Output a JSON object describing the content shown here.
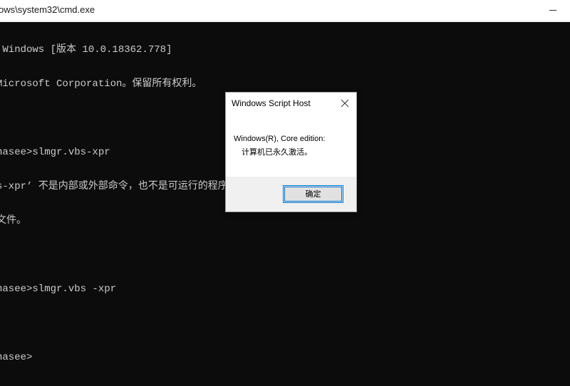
{
  "window": {
    "title": "ows\\system32\\cmd.exe"
  },
  "console": {
    "lines": [
      " Windows [版本 10.0.18362.778]",
      "Microsoft Corporation。保留所有权利。",
      "",
      "nasee>slmgr.vbs-xpr",
      "s-xpr’ 不是内部或外部命令，也不是可运行的程序",
      "文件。",
      "",
      "nasee>slmgr.vbs -xpr",
      "",
      "nasee>"
    ]
  },
  "dialog": {
    "title": "Windows Script Host",
    "message_line1": "Windows(R), Core edition:",
    "message_line2": "计算机已永久激活。",
    "ok_label": "确定"
  }
}
